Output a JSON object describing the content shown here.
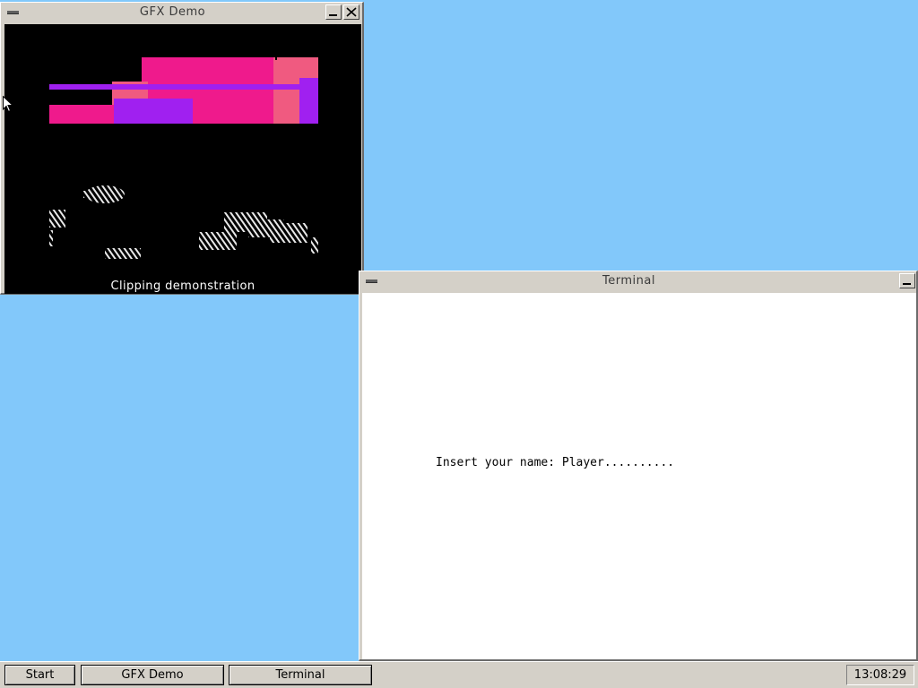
{
  "windows": {
    "gfx_demo": {
      "title": "GFX Demo",
      "caption": "Clipping demonstration"
    },
    "terminal": {
      "title": "Terminal",
      "lines": [
        "Insert your name: Player.........."
      ]
    }
  },
  "taskbar": {
    "start_label": "Start",
    "tasks": [
      {
        "label": "GFX Demo"
      },
      {
        "label": "Terminal"
      }
    ],
    "clock": "13:08:29"
  },
  "colors": {
    "desktop": "#82c8fa",
    "chrome": "#d4d0c8",
    "demo_magenta": "#ef1a8c",
    "demo_pink": "#f05a80",
    "demo_violet": "#a020f0"
  },
  "icons": {
    "system_menu": "system-menu-icon",
    "minimize": "minimize-icon",
    "close": "close-icon",
    "cursor": "arrow-cursor-icon"
  }
}
